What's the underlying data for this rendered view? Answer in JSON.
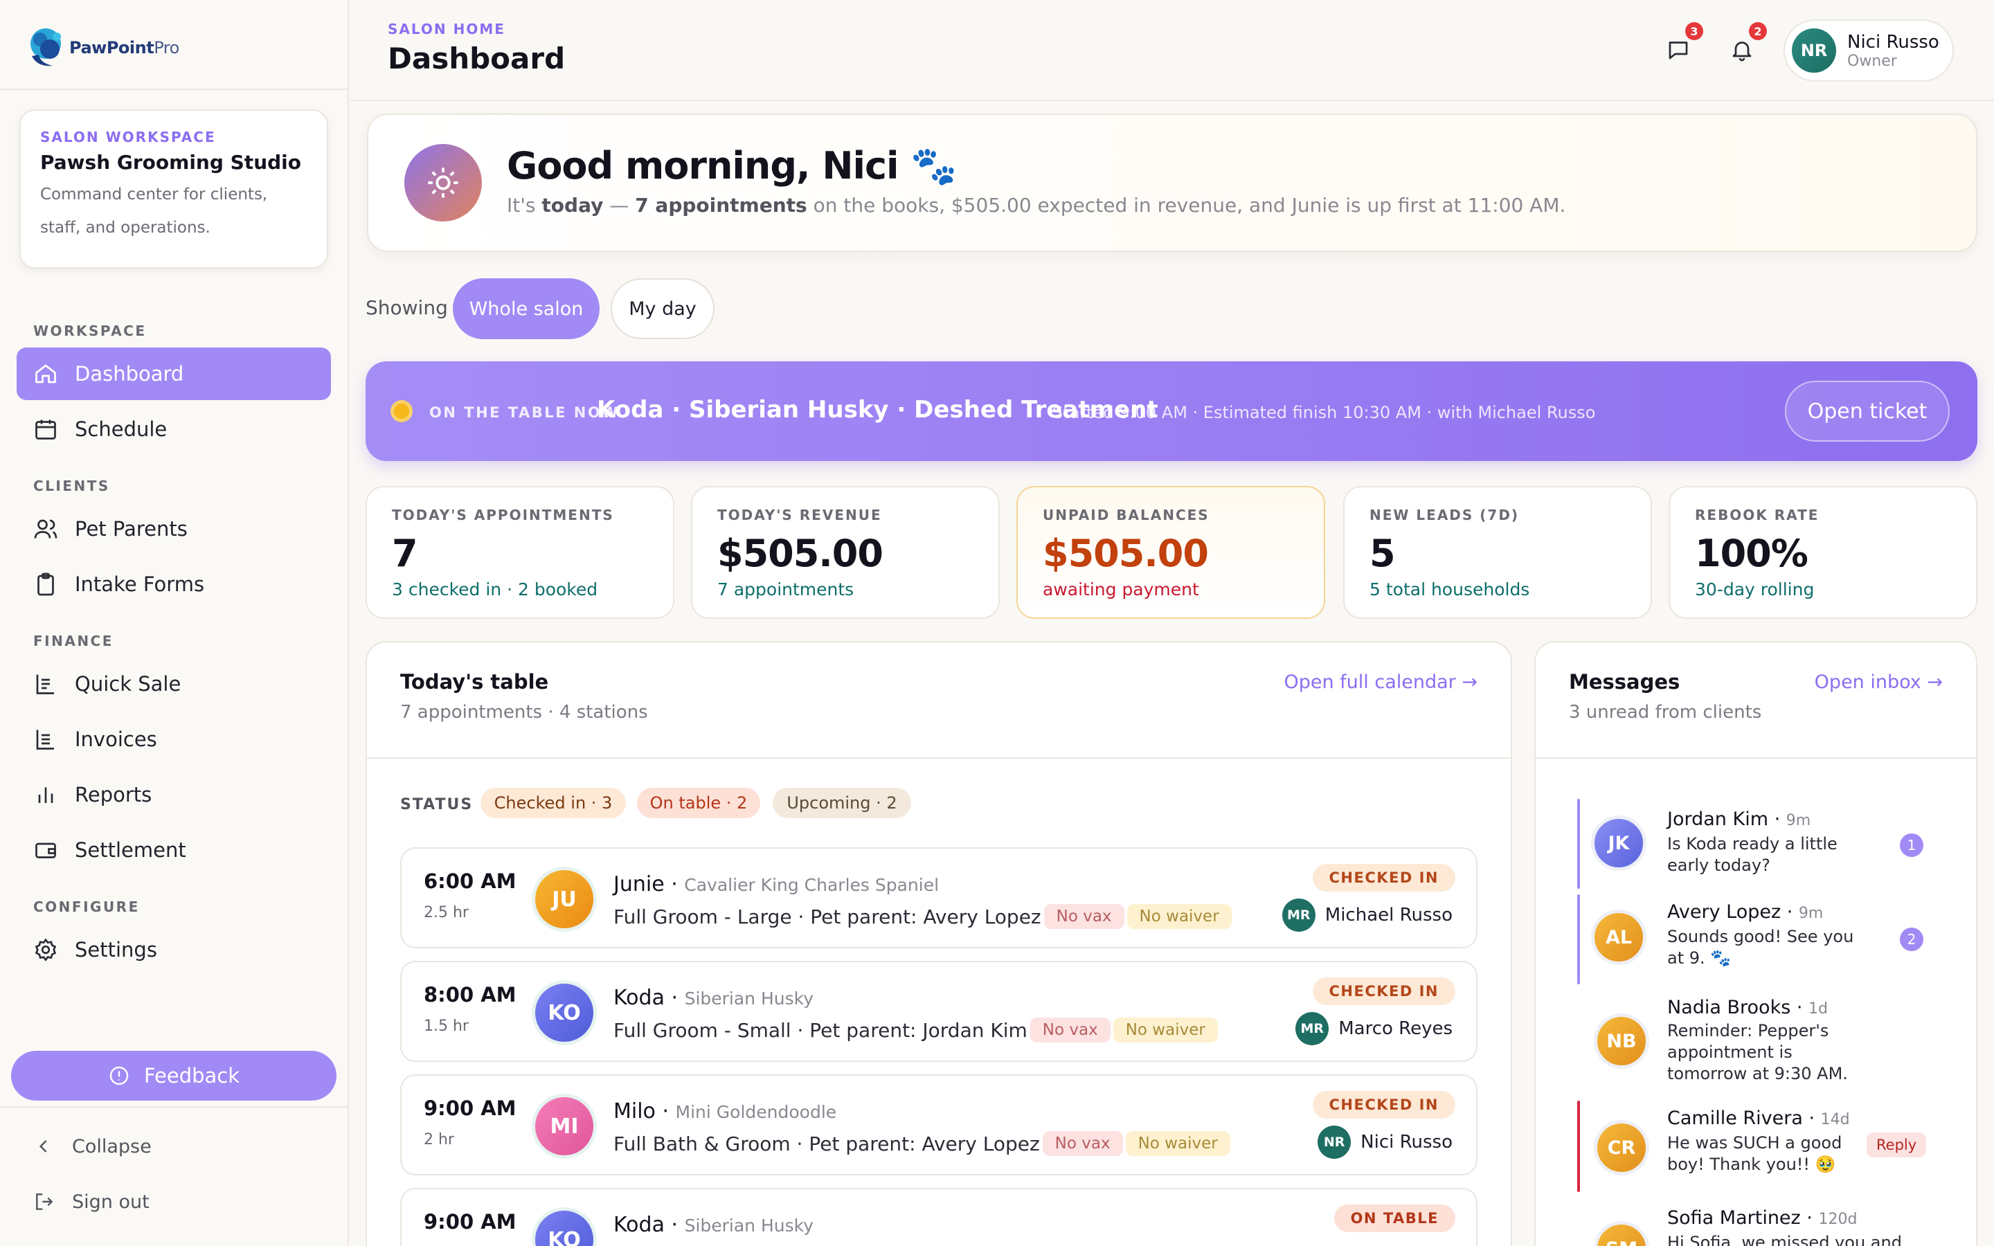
{
  "brand": {
    "name": "PawPoint",
    "suffix": "Pro"
  },
  "workspace": {
    "eyebrow": "SALON WORKSPACE",
    "name": "Pawsh Grooming Studio",
    "description": "Command center for clients, staff, and operations."
  },
  "nav": {
    "groups": {
      "workspace": "WORKSPACE",
      "clients": "CLIENTS",
      "finance": "FINANCE",
      "configure": "CONFIGURE"
    },
    "items": [
      {
        "label": "Dashboard",
        "icon": "home-icon",
        "active": true
      },
      {
        "label": "Schedule",
        "icon": "calendar-icon"
      },
      {
        "label": "Pet Parents",
        "icon": "users-icon"
      },
      {
        "label": "Intake Forms",
        "icon": "clipboard-icon"
      },
      {
        "label": "Quick Sale",
        "icon": "receipt-icon"
      },
      {
        "label": "Invoices",
        "icon": "invoice-icon"
      },
      {
        "label": "Reports",
        "icon": "bar-chart-icon"
      },
      {
        "label": "Settlement",
        "icon": "wallet-icon"
      },
      {
        "label": "Settings",
        "icon": "gear-icon"
      }
    ],
    "feedback": "Feedback",
    "collapse": "Collapse",
    "sign_out": "Sign out"
  },
  "header": {
    "breadcrumb": "SALON HOME",
    "title": "Dashboard",
    "messages_badge": "3",
    "notifications_badge": "2",
    "user": {
      "initials": "NR",
      "name": "Nici Russo",
      "role": "Owner"
    }
  },
  "greeting": {
    "title": "Good morning, Nici 🐾",
    "sub_prefix": "It's ",
    "sub_today": "today",
    "sub_dash": " — ",
    "sub_count": "7 appointments",
    "sub_rest": " on the books, $505.00 expected in revenue, and Junie is up first at 11:00 AM."
  },
  "filter": {
    "label": "Showing",
    "options": [
      "Whole salon",
      "My day"
    ],
    "selected": "Whole salon"
  },
  "now": {
    "eyebrow": "ON THE TABLE NOW",
    "title": "Koda · Siberian Husky · Deshed Treatment",
    "meta": "Started 9:00 AM · Estimated finish 10:30 AM · with Michael Russo",
    "button": "Open ticket"
  },
  "kpis": [
    {
      "label": "TODAY'S APPOINTMENTS",
      "value": "7",
      "sub": "3 checked in · 2 booked"
    },
    {
      "label": "TODAY'S REVENUE",
      "value": "$505.00",
      "sub": "7 appointments"
    },
    {
      "label": "UNPAID BALANCES",
      "value": "$505.00",
      "sub": "awaiting payment"
    },
    {
      "label": "NEW LEADS (7D)",
      "value": "5",
      "sub": "5 total households"
    },
    {
      "label": "REBOOK RATE",
      "value": "100%",
      "sub": "30-day rolling"
    }
  ],
  "today": {
    "title": "Today's table",
    "sub": "7 appointments · 4 stations",
    "link": "Open full calendar →",
    "status_label": "STATUS",
    "chips": [
      "Checked in · 3",
      "On table · 2",
      "Upcoming · 2"
    ],
    "appointments": [
      {
        "time": "6:00 AM",
        "duration": "2.5 hr",
        "initials": "JU",
        "pet": "Junie",
        "breed": "Cavalier King Charles Spaniel",
        "service": "Full Groom - Large · Pet parent: Avery Lopez",
        "tag_vax": "No vax",
        "tag_waiver": "No waiver",
        "status": "CHECKED IN",
        "staff_initials": "MR",
        "staff": "Michael Russo"
      },
      {
        "time": "8:00 AM",
        "duration": "1.5 hr",
        "initials": "KO",
        "pet": "Koda",
        "breed": "Siberian Husky",
        "service": "Full Groom - Small · Pet parent: Jordan Kim",
        "tag_vax": "No vax",
        "tag_waiver": "No waiver",
        "status": "CHECKED IN",
        "staff_initials": "MR",
        "staff": "Marco Reyes"
      },
      {
        "time": "9:00 AM",
        "duration": "2 hr",
        "initials": "MI",
        "pet": "Milo",
        "breed": "Mini Goldendoodle",
        "service": "Full Bath & Groom · Pet parent: Avery Lopez",
        "tag_vax": "No vax",
        "tag_waiver": "No waiver",
        "status": "CHECKED IN",
        "staff_initials": "NR",
        "staff": "Nici Russo"
      },
      {
        "time": "9:00 AM",
        "duration": "",
        "initials": "KO",
        "pet": "Koda",
        "breed": "Siberian Husky",
        "service": "",
        "tag_vax": "",
        "tag_waiver": "",
        "status": "ON TABLE",
        "staff_initials": "",
        "staff": ""
      }
    ]
  },
  "messages": {
    "title": "Messages",
    "sub": "3 unread from clients",
    "link": "Open inbox →",
    "items": [
      {
        "initials": "JK",
        "name": "Jordan Kim",
        "time": "9m",
        "text": "Is Koda ready a little early today?",
        "unread": "1"
      },
      {
        "initials": "AL",
        "name": "Avery Lopez",
        "time": "9m",
        "text": "Sounds good! See you at 9. 🐾",
        "unread": "2"
      },
      {
        "initials": "NB",
        "name": "Nadia Brooks",
        "time": "1d",
        "text": "Reminder: Pepper's appointment is tomorrow at 9:30 AM."
      },
      {
        "initials": "CR",
        "name": "Camille Rivera",
        "time": "14d",
        "text": "He was SUCH a good boy! Thank you!! 🥹",
        "tag": "Reply"
      },
      {
        "initials": "SM",
        "name": "Sofia Martinez",
        "time": "120d",
        "text": "Hi Sofia, we missed you and"
      }
    ]
  },
  "colors": {
    "accent": "#a18af5",
    "accent_dark": "#8b6df0",
    "teal": "#0e6e6b",
    "warn": "#c2410c"
  }
}
